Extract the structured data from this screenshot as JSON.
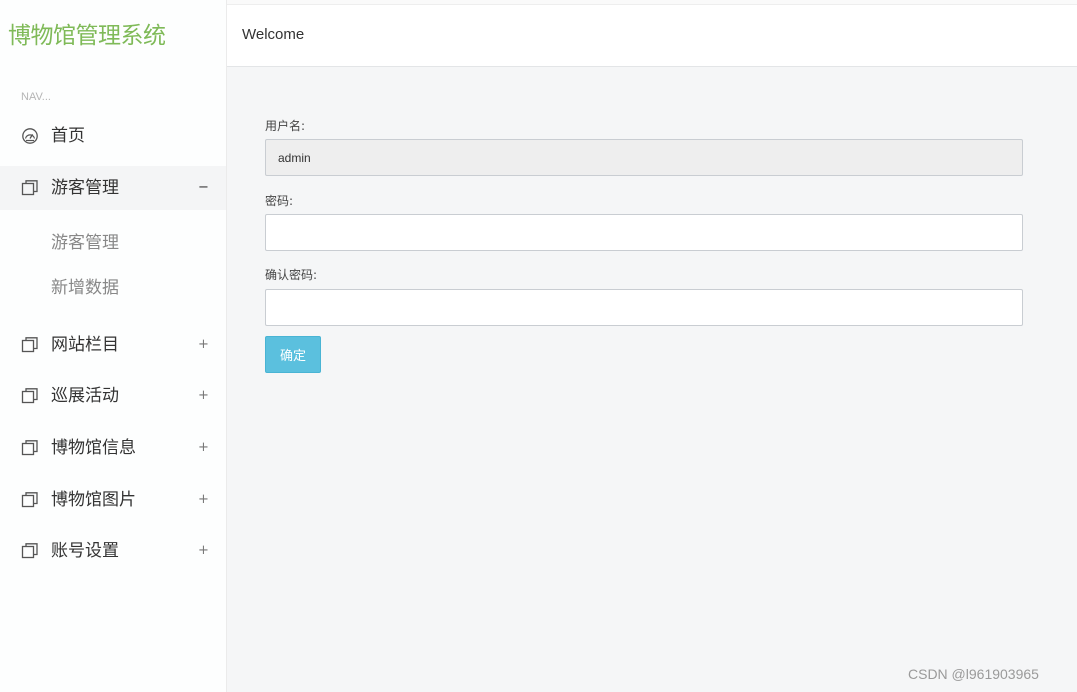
{
  "sidebar": {
    "brand": "博物馆管理系统",
    "nav_caption": "NAV...",
    "home": {
      "label": "首页",
      "icon": "dashboard-icon"
    },
    "menus": [
      {
        "label": "游客管理",
        "sign": "−",
        "expanded": true,
        "icon": "window-icon",
        "children": [
          {
            "label": "游客管理"
          },
          {
            "label": "新增数据"
          }
        ]
      },
      {
        "label": "网站栏目",
        "sign": "+",
        "expanded": false,
        "icon": "window-icon"
      },
      {
        "label": "巡展活动",
        "sign": "+",
        "expanded": false,
        "icon": "window-icon"
      },
      {
        "label": "博物馆信息",
        "sign": "+",
        "expanded": false,
        "icon": "window-icon"
      },
      {
        "label": "博物馆图片",
        "sign": "+",
        "expanded": false,
        "icon": "window-icon"
      },
      {
        "label": "账号设置",
        "sign": "+",
        "expanded": false,
        "icon": "window-icon"
      }
    ]
  },
  "header": {
    "welcome": "Welcome"
  },
  "form": {
    "username": {
      "label": "用户名:",
      "value": "admin",
      "disabled": true
    },
    "password": {
      "label": "密码:",
      "value": ""
    },
    "confirm_password": {
      "label": "确认密码:",
      "value": ""
    },
    "submit_label": "确定"
  },
  "watermark": "CSDN @l961903965",
  "colors": {
    "brand": "#7fba58",
    "button": "#5bc0de",
    "background": "#f5f6f7"
  }
}
